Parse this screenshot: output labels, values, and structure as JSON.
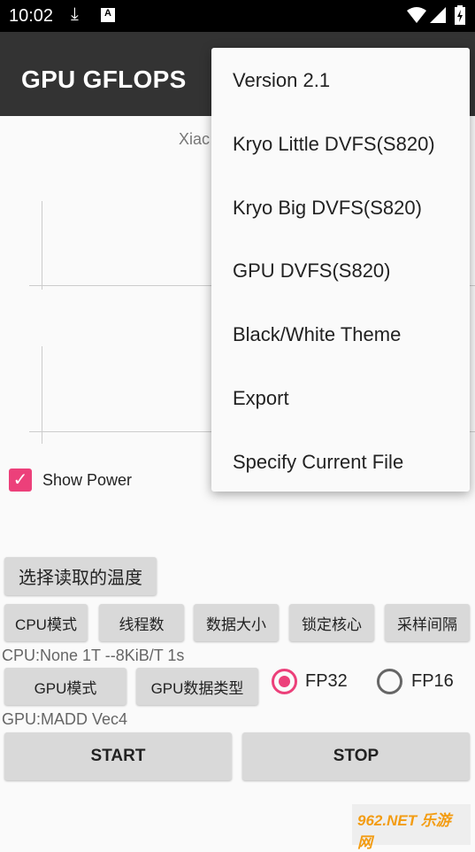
{
  "status": {
    "time": "10:02",
    "icons": [
      "download-icon",
      "a-notification-icon",
      "wifi-icon",
      "signal-icon",
      "battery-charging-icon"
    ]
  },
  "appbar": {
    "title": "GPU GFLOPS"
  },
  "chart": {
    "device_label_partial": "Xiac"
  },
  "show_power": {
    "label": "Show Power",
    "checked": true,
    "color": "#ec407a"
  },
  "buttons": {
    "temp": "选择读取的温度",
    "cpu_mode": "CPU模式",
    "threads": "线程数",
    "data_size": "数据大小",
    "lock_core": "锁定核心",
    "sample_interval": "采样间隔",
    "gpu_mode": "GPU模式",
    "gpu_data_type": "GPU数据类型",
    "start": "START",
    "stop": "STOP"
  },
  "cpu_info": "CPU:None 1T --8KiB/T 1s",
  "gpu_info": "GPU:MADD Vec4",
  "precision": {
    "options": [
      "FP32",
      "FP16"
    ],
    "selected": "FP32"
  },
  "menu": {
    "items": [
      "Version 2.1",
      "Kryo Little DVFS(S820)",
      "Kryo Big DVFS(S820)",
      "GPU DVFS(S820)",
      "Black/White Theme",
      "Export",
      "Specify Current File"
    ]
  },
  "watermark": "962.NET 乐游网"
}
